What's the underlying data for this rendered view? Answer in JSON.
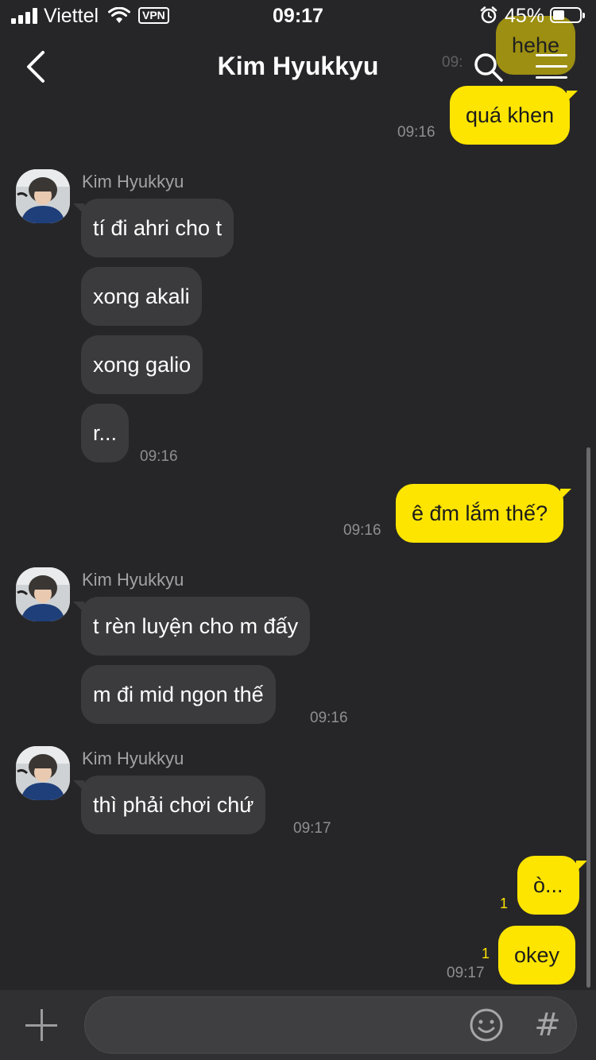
{
  "status_bar": {
    "carrier": "Viettel",
    "vpn": "VPN",
    "time": "09:17",
    "battery_percent": "45%",
    "battery_level": 0.45
  },
  "header": {
    "title": "Kim Hyukkyu",
    "icons": [
      "back-icon",
      "search-icon",
      "menu-icon"
    ]
  },
  "messages": {
    "m0": {
      "text": "hehe",
      "time": "09:"
    },
    "m1": {
      "text": "quá khen",
      "time": "09:16"
    },
    "g1": {
      "sender": "Kim Hyukkyu",
      "b1": "tí đi ahri cho t",
      "b2": "xong akali",
      "b3": "xong galio",
      "b4": "r...",
      "time": "09:16"
    },
    "m2": {
      "text": "ê đm lắm thế?",
      "time": "09:16"
    },
    "g2": {
      "sender": "Kim Hyukkyu",
      "b1": "t rèn luyện cho m đấy",
      "b2": "m đi mid ngon thế",
      "time": "09:16"
    },
    "g3": {
      "sender": "Kim Hyukkyu",
      "b1": "thì phải chơi chứ",
      "time": "09:17"
    },
    "m3": {
      "text": "ò...",
      "unread": "1"
    },
    "m4": {
      "text": "okey",
      "unread": "1",
      "time": "09:17"
    }
  },
  "input_bar": {
    "placeholder": "",
    "hash": "#"
  },
  "colors": {
    "background": "#262628",
    "my_bubble": "#fee500",
    "their_bubble": "#3b3b3d"
  }
}
